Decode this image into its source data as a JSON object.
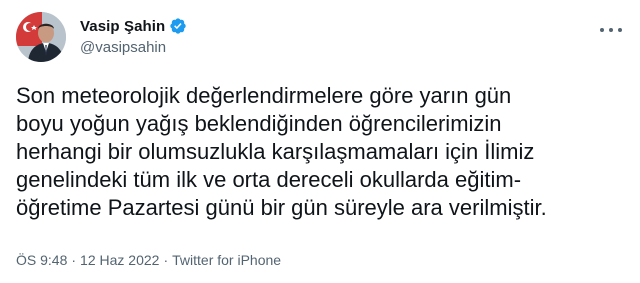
{
  "author": {
    "display_name": "Vasip Şahin",
    "handle": "@vasipsahin",
    "verified": true,
    "verified_color": "#1d9bf0",
    "avatar_icon": "profile-photo"
  },
  "menu": {
    "icon": "more-options-icon"
  },
  "tweet": {
    "lines": [
      "Son meteorolojik değerlendirmelere göre yarın gün",
      "boyu yoğun yağış beklendiğinden öğrencilerimizin",
      "herhangi bir olumsuzlukla karşılaşmamaları için İlimiz",
      "genelindeki tüm ilk ve orta dereceli okullarda eğitim-",
      "öğretime Pazartesi günü bir gün süreyle ara verilmiştir."
    ]
  },
  "meta": {
    "time": "ÖS 9:48",
    "date": "12 Haz 2022",
    "source": "Twitter for iPhone",
    "separator": "·"
  }
}
